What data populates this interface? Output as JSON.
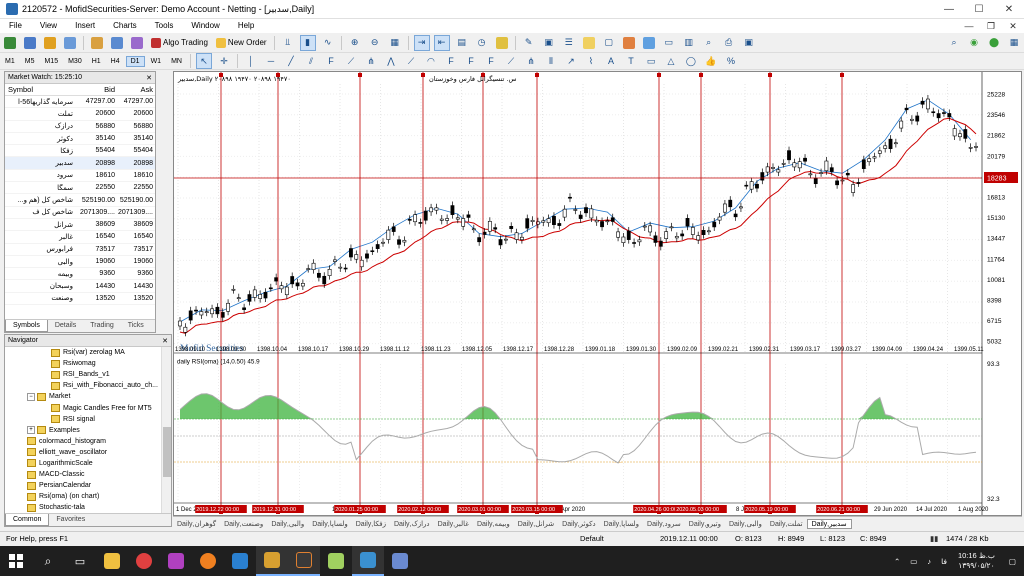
{
  "window": {
    "title": "2120572 - MofidSecurities-Server: Demo Account - Netting - [سدبیر,Daily]",
    "controls": [
      "—",
      "☐",
      "✕"
    ]
  },
  "menu": [
    "File",
    "View",
    "Insert",
    "Charts",
    "Tools",
    "Window",
    "Help"
  ],
  "menu_right": [
    "—",
    "❐",
    "✕"
  ],
  "toolbar": {
    "algo_trading": "Algo Trading",
    "new_order": "New Order",
    "timeframes": [
      "M1",
      "M5",
      "M15",
      "M30",
      "H1",
      "H4",
      "D1",
      "W1",
      "MN"
    ],
    "active_timeframe": "D1"
  },
  "market_watch": {
    "title": "Market Watch: 15:25:10",
    "columns": [
      "Symbol",
      "Bid",
      "Ask"
    ],
    "rows": [
      {
        "symbol": "سرمایه گذاریها56-ا",
        "bid": "47297.00",
        "ask": "47297.00"
      },
      {
        "symbol": "تملت",
        "bid": "20600",
        "ask": "20600"
      },
      {
        "symbol": "درازک",
        "bid": "56880",
        "ask": "56880"
      },
      {
        "symbol": "دکوثر",
        "bid": "35140",
        "ask": "35140"
      },
      {
        "symbol": "زفکا",
        "bid": "55404",
        "ask": "55404"
      },
      {
        "symbol": "سدبیر",
        "bid": "20898",
        "ask": "20898"
      },
      {
        "symbol": "سرود",
        "bid": "18610",
        "ask": "18610"
      },
      {
        "symbol": "سمگا",
        "bid": "22550",
        "ask": "22550"
      },
      {
        "symbol": "شاخص کل (هم و...",
        "bid": "525190.00",
        "ask": "525190.00"
      },
      {
        "symbol": "شاخص کل ف",
        "bid": "2071309....",
        "ask": "2071309...."
      },
      {
        "symbol": "شرانل",
        "bid": "38609",
        "ask": "38609"
      },
      {
        "symbol": "غالبر",
        "bid": "16540",
        "ask": "16540"
      },
      {
        "symbol": "فرابورس",
        "bid": "73517",
        "ask": "73517"
      },
      {
        "symbol": "والبی",
        "bid": "19060",
        "ask": "19060"
      },
      {
        "symbol": "وبیمه",
        "bid": "9360",
        "ask": "9360"
      },
      {
        "symbol": "وسبحان",
        "bid": "14430",
        "ask": "14430"
      },
      {
        "symbol": "وصنعت",
        "bid": "13520",
        "ask": "13520"
      }
    ],
    "tabs": [
      "Symbols",
      "Details",
      "Trading",
      "Ticks"
    ]
  },
  "navigator": {
    "title": "Navigator",
    "items": [
      {
        "label": "Rsi(var) zerolag MA",
        "level": 2,
        "type": "indicator"
      },
      {
        "label": "Rsiwomag",
        "level": 2,
        "type": "indicator"
      },
      {
        "label": "RSI_Bands_v1",
        "level": 2,
        "type": "indicator"
      },
      {
        "label": "Rsi_with_Fibonacci_auto_ch...",
        "level": 2,
        "type": "indicator"
      },
      {
        "label": "Market",
        "level": 1,
        "type": "folder"
      },
      {
        "label": "Magic Candles Free for MT5",
        "level": 2,
        "type": "indicator"
      },
      {
        "label": "RSI signal",
        "level": 2,
        "type": "indicator"
      },
      {
        "label": "Examples",
        "level": 1,
        "type": "folder"
      },
      {
        "label": "colormacd_histogram",
        "level": 1,
        "type": "indicator"
      },
      {
        "label": "elliott_wave_oscillator",
        "level": 1,
        "type": "indicator"
      },
      {
        "label": "LogarithmicScale",
        "level": 1,
        "type": "indicator"
      },
      {
        "label": "MACD-Classic",
        "level": 1,
        "type": "indicator"
      },
      {
        "label": "PersianCalendar",
        "level": 1,
        "type": "indicator"
      },
      {
        "label": "Rsi(oma) (on chart)",
        "level": 1,
        "type": "indicator"
      },
      {
        "label": "Stochastic-tala",
        "level": 1,
        "type": "indicator"
      }
    ],
    "tabs": [
      "Common",
      "Favorites"
    ]
  },
  "chart": {
    "header": "سدبیر,Daily  ۲۰۸۹۸  ۱۹۴۷۰  ۲۰۸۹۸  ۱۹۴۷۰",
    "header_note": "س. تنسیگرانل فارس وخوزستان",
    "watermark": "Mofid Securities",
    "price_ticks": [
      "25228",
      "23546",
      "21862",
      "20179",
      "18497",
      "16813",
      "15130",
      "13447",
      "11764",
      "10081",
      "8398",
      "6715",
      "5032"
    ],
    "current_price": "18283",
    "top_date_labels": [
      "1398.09.10",
      "1398.09.30",
      "1398.10.04",
      "1398.10.17",
      "1398.10.29",
      "1398.11.12",
      "1398.11.23",
      "1398.12.05",
      "1398.12.17",
      "1398.12.28",
      "1399.01.18",
      "1399.01.30",
      "1399.02.09",
      "1399.02.21",
      "1399.02.31",
      "1399.03.17",
      "1399.03.27",
      "1399.04.09",
      "1399.04.24",
      "1399.05.11"
    ],
    "bottom_date_labels": [
      "1 Dec 2019",
      "14 Jan 2020",
      "6 Apr 2020",
      "8 Jun 2020",
      "29 Jun 2020",
      "14 Jul 2020",
      "1 Aug 2020"
    ],
    "marker_dates": [
      "2019.12.22 00:00",
      "2019.12.31 00:00",
      "2020.01.25 00:00",
      "2020.02.12 00:00",
      "2020.03.01 00:00",
      "2020.03.15 00:00",
      "2020.04.26 00:00",
      "2020.05.03 00:00",
      "2020.05.19 00:00",
      "2020.06.21 00:00"
    ],
    "rsi_label": "daily RSI(oma) (14,0.50) 45.9",
    "rsi_top": "93.3",
    "rsi_bottom": "32.3"
  },
  "chart_tabs": [
    "گوهران,Daily",
    "وصنعت,Daily",
    "والبی,Daily",
    "ولساپا,Daily",
    "زفکا,Daily",
    "درازک,Daily",
    "غالبر,Daily",
    "وبیمه,Daily",
    "شرانل,Daily",
    "دکوثر,Daily",
    "ولساپا,Daily",
    "سرود,Daily",
    "وتیرو,Daily",
    "والبی,Daily",
    "تملت,Daily",
    "سدبیر,Daily"
  ],
  "active_chart_tab": "سدبیر,Daily",
  "status": {
    "help": "For Help, press F1",
    "profile": "Default",
    "datetime": "2019.12.11 00:00",
    "open": "O: 8123",
    "high": "H: 8949",
    "low": "L: 8123",
    "close": "C: 8949",
    "traffic": "1474 / 28 Kb"
  },
  "taskbar": {
    "time": "10:16 ب.ظ",
    "date": "۱۳۹۹/۰۵/۲۰",
    "lang": "فا"
  },
  "colors": {
    "candles": "#000000",
    "ma_line": "#cc0000",
    "trend_line": "#1e73c8",
    "markers": "#c00000",
    "rsi_up_fill": "#3cb33c",
    "rsi_down_fill": "#f0a020",
    "rsi_line": "#aaaaaa"
  }
}
